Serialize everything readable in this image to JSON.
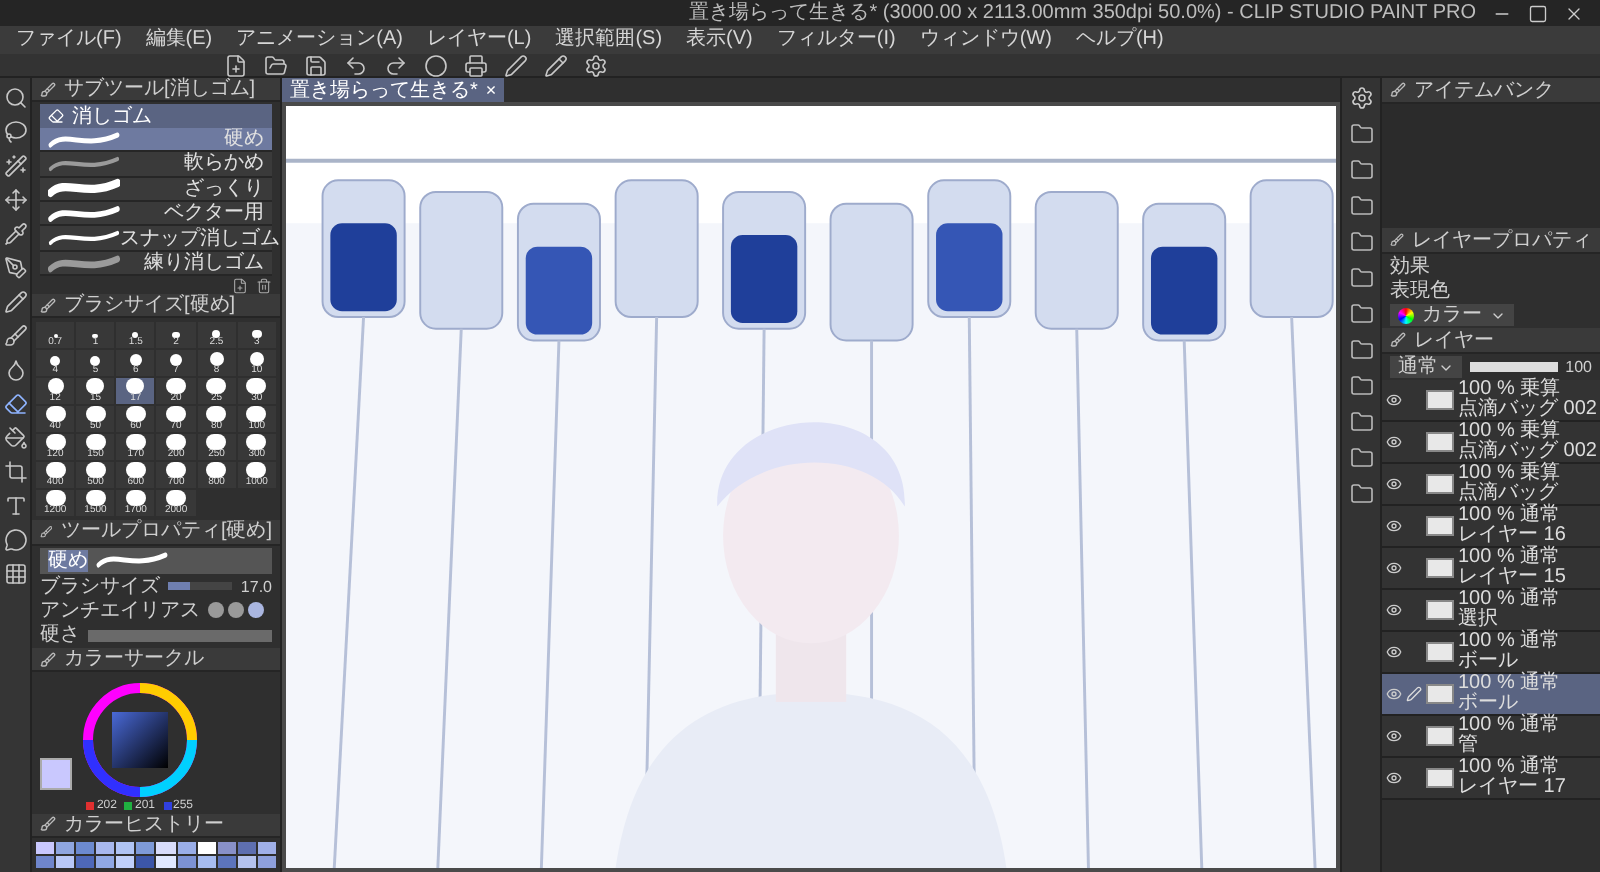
{
  "title_bar": {
    "title": "置き場らって生きる* (3000.00 x 2113.00mm 350dpi 50.0%) - CLIP STUDIO PAINT PRO"
  },
  "menu": [
    "ファイル(F)",
    "編集(E)",
    "アニメーション(A)",
    "レイヤー(L)",
    "選択範囲(S)",
    "表示(V)",
    "フィルター(I)",
    "ウィンドウ(W)",
    "ヘルプ(H)"
  ],
  "document_tab": {
    "title": "置き場らって生きる*",
    "close": "×"
  },
  "sub_tool": {
    "title": "サブツール[消しゴム]",
    "group": "消しゴム",
    "items": [
      {
        "label": "硬め",
        "selected": true
      },
      {
        "label": "軟らかめ",
        "selected": false
      },
      {
        "label": "ざっくり",
        "selected": false
      },
      {
        "label": "ベクター用",
        "selected": false
      },
      {
        "label": "スナップ消しゴム",
        "selected": false
      },
      {
        "label": "練り消しゴム",
        "selected": false
      }
    ]
  },
  "brush_size": {
    "title": "ブラシサイズ[硬め]",
    "sizes": [
      {
        "label": "0.7",
        "selected": false
      },
      {
        "label": "1",
        "selected": false
      },
      {
        "label": "1.5",
        "selected": false
      },
      {
        "label": "2",
        "selected": false
      },
      {
        "label": "2.5",
        "selected": false
      },
      {
        "label": "3",
        "selected": false
      },
      {
        "label": "4",
        "selected": false
      },
      {
        "label": "5",
        "selected": false
      },
      {
        "label": "6",
        "selected": false
      },
      {
        "label": "7",
        "selected": false
      },
      {
        "label": "8",
        "selected": false
      },
      {
        "label": "10",
        "selected": false
      },
      {
        "label": "12",
        "selected": false
      },
      {
        "label": "15",
        "selected": false
      },
      {
        "label": "17",
        "selected": true
      },
      {
        "label": "20",
        "selected": false
      },
      {
        "label": "25",
        "selected": false
      },
      {
        "label": "30",
        "selected": false
      },
      {
        "label": "40",
        "selected": false
      },
      {
        "label": "50",
        "selected": false
      },
      {
        "label": "60",
        "selected": false
      },
      {
        "label": "70",
        "selected": false
      },
      {
        "label": "80",
        "selected": false
      },
      {
        "label": "100",
        "selected": false
      },
      {
        "label": "120",
        "selected": false
      },
      {
        "label": "150",
        "selected": false
      },
      {
        "label": "170",
        "selected": false
      },
      {
        "label": "200",
        "selected": false
      },
      {
        "label": "250",
        "selected": false
      },
      {
        "label": "300",
        "selected": false
      },
      {
        "label": "400",
        "selected": false
      },
      {
        "label": "500",
        "selected": false
      },
      {
        "label": "600",
        "selected": false
      },
      {
        "label": "700",
        "selected": false
      },
      {
        "label": "800",
        "selected": false
      },
      {
        "label": "1000",
        "selected": false
      },
      {
        "label": "1200",
        "selected": false
      },
      {
        "label": "1500",
        "selected": false
      },
      {
        "label": "1700",
        "selected": false
      },
      {
        "label": "2000",
        "selected": false
      }
    ]
  },
  "tool_property": {
    "title": "ツールプロパティ[硬め]",
    "preset": "硬め",
    "brush_size_label": "ブラシサイズ",
    "brush_size_value": "17.0",
    "level": 0.35,
    "anti_alias_label": "アンチエイリアス",
    "hardness_label": "硬さ"
  },
  "color_circle": {
    "title": "カラーサークル",
    "values": [
      {
        "text": "202",
        "color": "#e03030"
      },
      {
        "text": "201",
        "color": "#20b040"
      },
      {
        "text": "255",
        "color": "#3040e0"
      }
    ]
  },
  "color_history": {
    "title": "カラーヒストリー",
    "swatches": [
      {
        "color": "#c9c8fe"
      },
      {
        "color": "#8fa6e0"
      },
      {
        "color": "#6c8ad0"
      },
      {
        "color": "#a8b8ee"
      },
      {
        "color": "#b0c4f4"
      },
      {
        "color": "#7e9ad8"
      },
      {
        "color": "#d8dcfa"
      },
      {
        "color": "#9aaee8"
      },
      {
        "color": "#ffffff"
      },
      {
        "color": "#8890c8"
      },
      {
        "color": "#5e6fb0"
      },
      {
        "color": "#a0b0e8"
      },
      {
        "color": "#6f86cc"
      },
      {
        "color": "#b8c8f8"
      },
      {
        "color": "#4e68b8"
      },
      {
        "color": "#90a8e4"
      },
      {
        "color": "#c0d0fa"
      },
      {
        "color": "#3c56a8"
      },
      {
        "color": "#e0e8ff"
      },
      {
        "color": "#7c92d4"
      },
      {
        "color": "#a6bcf0"
      },
      {
        "color": "#5c74bc"
      },
      {
        "color": "#b4c2ee"
      },
      {
        "color": "#8ea0dc"
      }
    ]
  },
  "item_bank": {
    "title": "アイテムバンク"
  },
  "layer_property": {
    "title": "レイヤープロパティ",
    "effect_label": "効果",
    "expression_color_label": "表現色",
    "expression_color": "カラー"
  },
  "layers_panel": {
    "title": "レイヤー",
    "blend_mode": "通常",
    "opacity": "100",
    "layers": [
      {
        "mode": "100 % 乗算",
        "name": "点滴バッグ 002",
        "selected": false,
        "editing": false
      },
      {
        "mode": "100 % 乗算",
        "name": "点滴バッグ 002",
        "selected": false,
        "editing": false
      },
      {
        "mode": "100 % 乗算",
        "name": "点滴バッグ",
        "selected": false,
        "editing": false
      },
      {
        "mode": "100 % 通常",
        "name": "レイヤー 16",
        "selected": false,
        "editing": false
      },
      {
        "mode": "100 % 通常",
        "name": "レイヤー 15",
        "selected": false,
        "editing": false
      },
      {
        "mode": "100 % 通常",
        "name": "選択",
        "selected": false,
        "editing": false
      },
      {
        "mode": "100 % 通常",
        "name": "ボール",
        "selected": false,
        "editing": false
      },
      {
        "mode": "100 % 通常",
        "name": "ボール",
        "selected": true,
        "editing": true
      },
      {
        "mode": "100 % 通常",
        "name": "管",
        "selected": false,
        "editing": false
      },
      {
        "mode": "100 % 通常",
        "name": "レイヤー 17",
        "selected": false,
        "editing": false
      }
    ]
  }
}
